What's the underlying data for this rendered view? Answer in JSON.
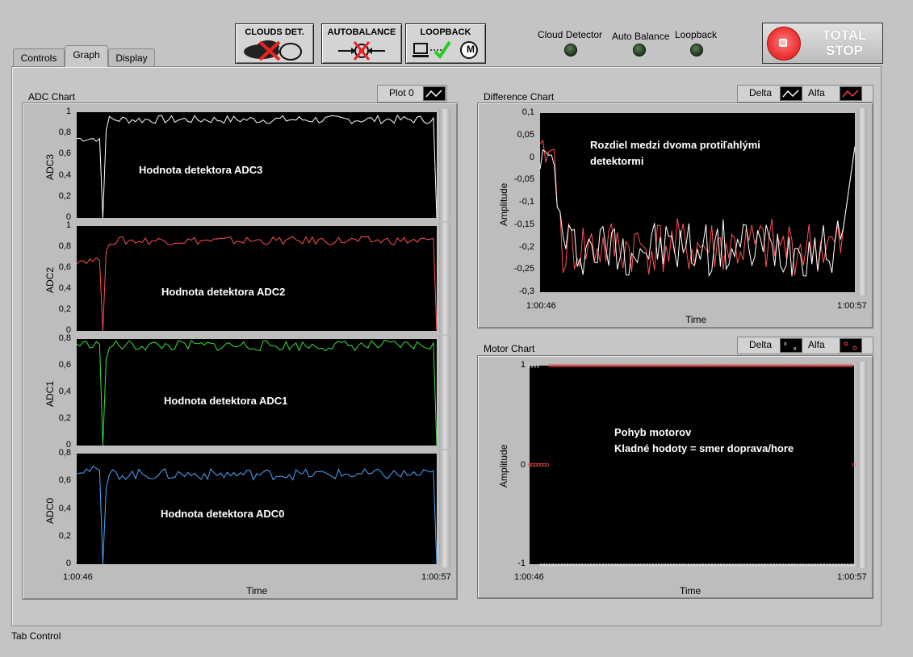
{
  "tabs": [
    "Controls",
    "Graph",
    "Display"
  ],
  "active_tab": "Graph",
  "tab_control_label": "Tab Control",
  "buttons": {
    "clouds": "CLOUDS DET.",
    "autobalance": "AUTOBALANCE",
    "loopback": "LOOPBACK",
    "loopback_m": "M"
  },
  "leds": [
    "Cloud Detector",
    "Auto Balance",
    "Loopback"
  ],
  "stop": {
    "line1": "TOTAL",
    "line2": "STOP"
  },
  "adc_chart": {
    "title": "ADC Chart",
    "legend": "Plot 0",
    "xlabel": "Time",
    "x_start": "1:00:46",
    "x_end": "1:00:57",
    "panels": [
      {
        "ylabel": "ADC3",
        "annotation": "Hodnota detektora ADC3",
        "yticks": [
          "1",
          "0,8",
          "0,6",
          "0,4",
          "0,2",
          "0"
        ],
        "color": "#ffffff"
      },
      {
        "ylabel": "ADC2",
        "annotation": "Hodnota detektora ADC2",
        "yticks": [
          "1",
          "0,8",
          "0,6",
          "0,4",
          "0,2",
          "0"
        ],
        "color": "#ff5050"
      },
      {
        "ylabel": "ADC1",
        "annotation": "Hodnota detektora ADC1",
        "yticks": [
          "0,8",
          "0,6",
          "0,4",
          "0,2",
          "0"
        ],
        "color": "#3ce03c"
      },
      {
        "ylabel": "ADC0",
        "annotation": "Hodnota detektora ADC0",
        "yticks": [
          "0,8",
          "0,6",
          "0,4",
          "0,2",
          "0"
        ],
        "color": "#4aa8ff"
      }
    ]
  },
  "diff_chart": {
    "title": "Difference Chart",
    "legend": [
      "Delta",
      "Alfa"
    ],
    "xlabel": "Time",
    "ylabel": "Amplitude",
    "x_start": "1:00:46",
    "x_end": "1:00:57",
    "yticks": [
      "0,1",
      "0,05",
      "0",
      "-0,05",
      "-0,1",
      "-0,15",
      "-0,2",
      "-0,25",
      "-0,3"
    ],
    "annotation": [
      "Rozdiel medzi dvoma protiľahlými",
      "detektormi"
    ],
    "colors": {
      "delta": "#ffffff",
      "alfa": "#ff5050"
    }
  },
  "motor_chart": {
    "title": "Motor Chart",
    "legend": [
      "Delta",
      "Alfa"
    ],
    "xlabel": "Time",
    "ylabel": "Amplitude",
    "x_start": "1:00:46",
    "x_end": "1:00:57",
    "yticks": [
      "1",
      "0",
      "-1"
    ],
    "annotation": [
      "Pohyb motorov",
      "Kladné hodoty = smer doprava/hore"
    ]
  }
}
